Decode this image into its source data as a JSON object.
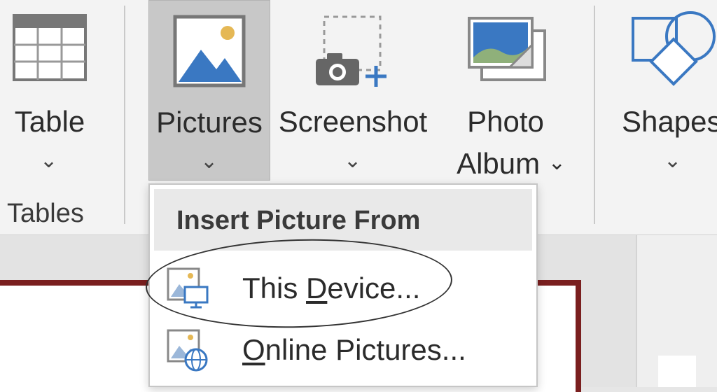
{
  "ribbon": {
    "buttons": {
      "table": {
        "label": "Table"
      },
      "pictures": {
        "label": "Pictures"
      },
      "screenshot": {
        "label": "Screenshot"
      },
      "photo_album": {
        "line1": "Photo",
        "line2": "Album"
      },
      "shapes": {
        "label": "Shapes"
      }
    },
    "groups": {
      "tables": "Tables"
    }
  },
  "dropdown": {
    "header": "Insert Picture From",
    "items": [
      {
        "label_pre": "This ",
        "label_accel": "D",
        "label_post": "evice..."
      },
      {
        "label_pre": "",
        "label_accel": "O",
        "label_post": "nline Pictures..."
      }
    ]
  },
  "colors": {
    "accent_blue": "#3a78c2",
    "slide_border": "#7a1f1f",
    "pressed_button": "#c8c8c8"
  },
  "icons": [
    "table-icon",
    "pictures-icon",
    "screenshot-icon",
    "photo-album-icon",
    "shapes-icon",
    "this-device-icon",
    "online-pictures-icon",
    "chevron-down-icon"
  ]
}
